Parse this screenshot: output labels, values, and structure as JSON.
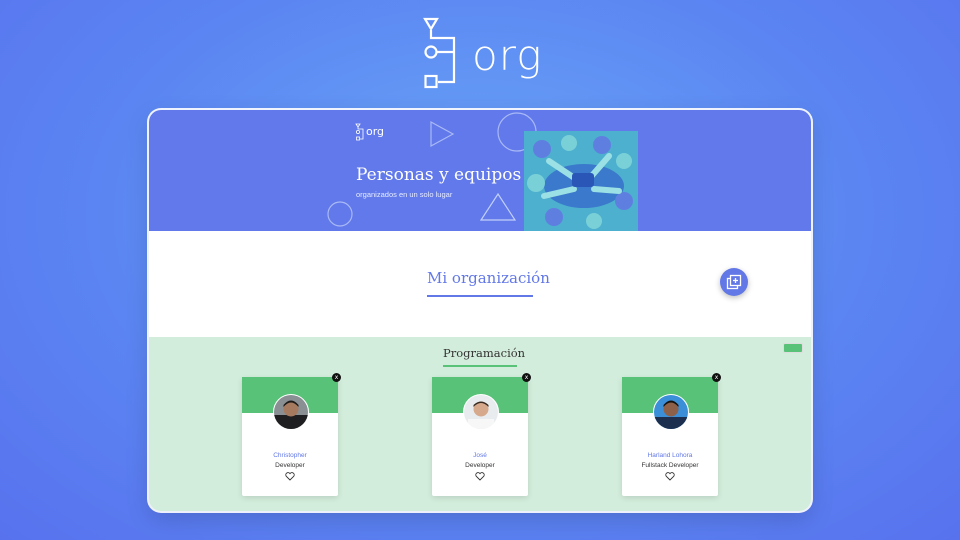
{
  "logo": {
    "text": "org",
    "icon": "org-chart-logo-icon"
  },
  "banner": {
    "logo_text": "org",
    "title": "Personas y equipos",
    "subtitle": "organizados en un solo lugar"
  },
  "organization": {
    "title": "Mi organización",
    "add_button_icon": "add-collaborator-icon"
  },
  "team": {
    "name": "Programación",
    "primary_color": "#57c278",
    "secondary_color": "#d3eddc",
    "members": [
      {
        "name": "Christopher",
        "role": "Developer",
        "remove_label": "x"
      },
      {
        "name": "José",
        "role": "Developer",
        "remove_label": "x"
      },
      {
        "name": "Harland Lohora",
        "role": "Fullstack Developer",
        "remove_label": "x"
      }
    ]
  },
  "colors": {
    "background": "#5b86f2",
    "banner": "#6179ea",
    "accent": "#6278e6"
  }
}
